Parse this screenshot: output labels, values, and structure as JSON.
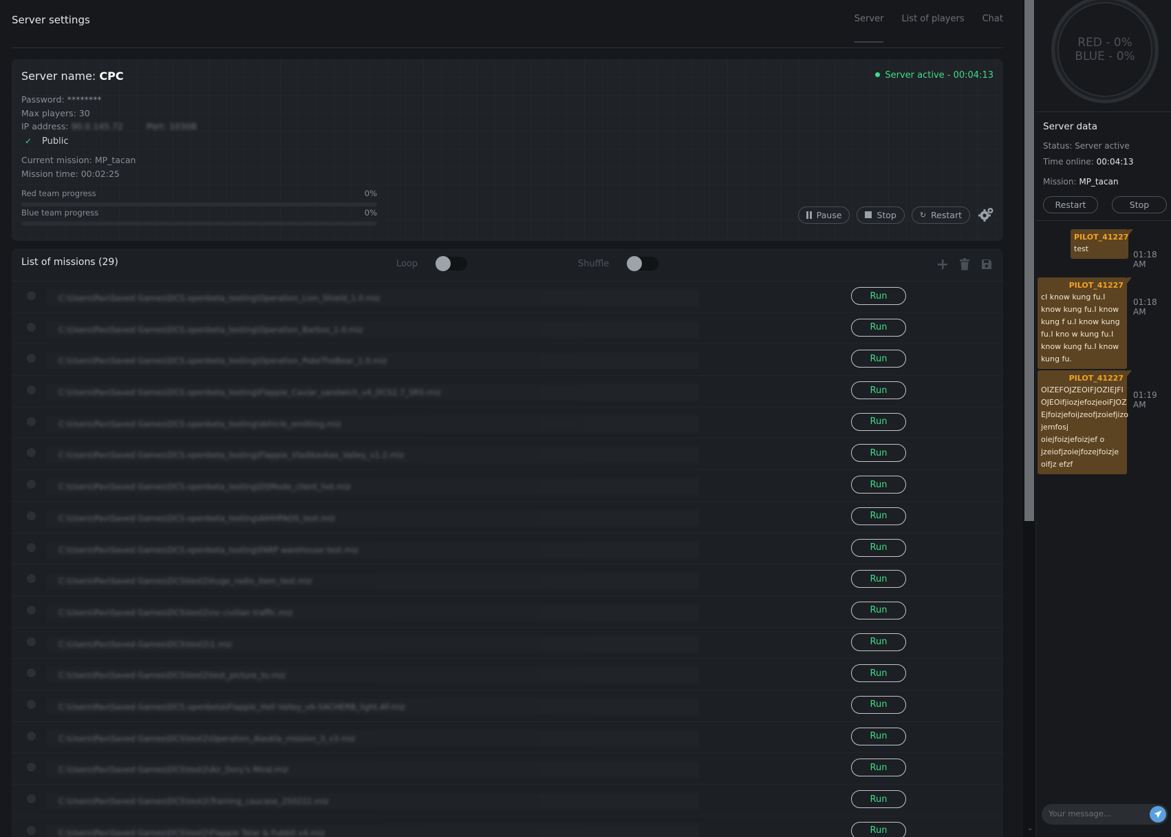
{
  "page": {
    "title": "Server settings",
    "tabs": [
      "Server",
      "List of players",
      "Chat"
    ]
  },
  "server": {
    "name_prefix": "Server name:",
    "name": "CPC",
    "status": "Server active - 00:04:13",
    "password": "Password: ********",
    "max_players": "Max players: 30",
    "ip_label": "IP address:",
    "ip_value": "90.0.145.72",
    "port_value": "Port: 10308",
    "public_label": "Public",
    "current_mission": "Current mission: MP_tacan",
    "mission_time": "Mission time: 00:02:25",
    "red_progress_label": "Red team progress",
    "red_progress_value": "0%",
    "red_progress_fraction": 0,
    "blue_progress_label": "Blue team progress",
    "blue_progress_value": "0%",
    "blue_progress_fraction": 0,
    "actions": {
      "pause": "Pause",
      "stop": "Stop",
      "restart": "Restart"
    }
  },
  "missions": {
    "title": "List of missions (29)",
    "loop_label": "Loop",
    "shuffle_label": "Shuffle",
    "run_label": "Run",
    "items": [
      "C:\\Users\\Pav\\Saved Games\\DCS.openbeta_testing\\Operation_Lion_Shield_1.0.miz",
      "C:\\Users\\Pav\\Saved Games\\DCS.openbeta_testing\\Operation_Barbos_1.0.miz",
      "C:\\Users\\Pav\\Saved Games\\DCS.openbeta_testing\\Operation_PokeTheBear_1.0.miz",
      "C:\\Users\\Pav\\Saved Games\\DCS.openbeta_testing\\Flappie_Caviar_sandwich_v4_DCS2.7_SRS.miz",
      "C:\\Users\\Pav\\Saved Games\\DCS.openbeta_testing\\Vehicle_emitting.miz",
      "C:\\Users\\Pav\\Saved Games\\DCS.openbeta_testing\\Flappie_Vladikavkas_Valley_v1.2.miz",
      "C:\\Users\\Pav\\Saved Games\\DCS.openbeta_testing\\DSMode_client_hot.miz",
      "C:\\Users\\Pav\\Saved Games\\DCS.openbeta_testing\\AIHHPAOS_test.miz",
      "C:\\Users\\Pav\\Saved Games\\DCS.openbeta_testing\\FARP warehouse test.miz",
      "C:\\Users\\Pav\\Saved Games\\DCS\\test2\\huge_radio_item_test.miz",
      "C:\\Users\\Pav\\Saved Games\\DCS\\test2\\no civilian traffic.miz",
      "C:\\Users\\Pav\\Saved Games\\DCS\\test2\\1.miz",
      "C:\\Users\\Pav\\Saved Games\\DCS\\test2\\test_picture_to.miz",
      "C:\\Users\\Pav\\Saved Games\\DCS.openbeta\\Flappie_Hell Valley_v6-SACHERB_light.AF.miz",
      "C:\\Users\\Pav\\Saved Games\\DCS\\test2\\Operation_Alaskla_mission_3_v3.miz",
      "C:\\Users\\Pav\\Saved Games\\DCS\\test2\\Air_Dory's Mind.miz",
      "C:\\Users\\Pav\\Saved Games\\DCS\\test2\\Training_caucase_250222.miz",
      "C:\\Users\\Pav\\Saved Games\\DCS\\test2\\Flappie Talar & Fubbit v4.miz"
    ]
  },
  "sidebar": {
    "red_score": "RED - 0%",
    "blue_score": "BLUE - 0%",
    "server_data_title": "Server data",
    "status": "Status: Server active",
    "time_online_label": "Time online:",
    "time_online_value": "00:04:13",
    "mission_label": "Mission:",
    "mission_value": "MP_tacan",
    "restart_label": "Restart",
    "stop_label": "Stop"
  },
  "chat": {
    "messages": [
      {
        "author": "PILOT_41227",
        "text": "test",
        "time": "01:18 AM"
      },
      {
        "author": "PILOT_41227",
        "text": "cI know kung fu.I know kung fu.I know kung f u.I know kung fu.I kno w kung fu.I know kung fu.I know kung fu.",
        "time": "01:18 AM"
      },
      {
        "author": "PILOT_41227",
        "text": "OIZEFOJZEOIFJOZIEJFI OJEOifjiozjefozjeoiFJOZ Ejfoizjefoijzeofjzoiefjizo jemfosj oiejfoizjefoizjef o jzeiofjzoiejfozejfoizje oifjz efzf",
        "time": "01:19 AM"
      }
    ],
    "input_placeholder": "Your message..."
  },
  "colors": {
    "status_green": "#3fdc8a",
    "chat_author": "#f3a324",
    "chat_bubble": "#5c4321",
    "send_button": "#5aa0e0"
  },
  "icons": [
    "checkmark-icon",
    "pause-icon",
    "stop-icon",
    "restart-icon",
    "gear-icon",
    "plus-icon",
    "trash-icon",
    "save-icon",
    "send-icon",
    "chevron-down-icon"
  ]
}
